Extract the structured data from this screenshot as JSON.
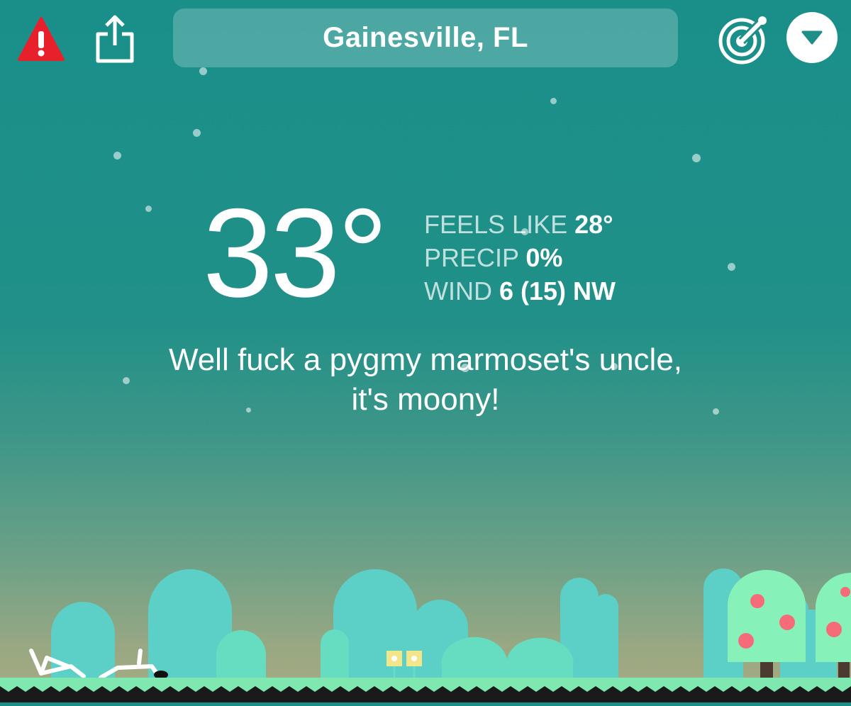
{
  "header": {
    "location": "Gainesville, FL",
    "alert_icon": "alert-triangle-icon",
    "share_icon": "share-icon",
    "radar_icon": "radar-icon",
    "menu_icon": "chevron-down-icon"
  },
  "weather": {
    "temperature": "33°",
    "feels_like_label": "FEELS LIKE",
    "feels_like_value": "28°",
    "precip_label": "PRECIP",
    "precip_value": "0%",
    "wind_label": "WIND",
    "wind_value": "6 (15) NW"
  },
  "message": {
    "line1": "Well fuck a pygmy marmoset's uncle,",
    "line2": "it's moony!"
  },
  "colors": {
    "sky_top": "#1a8f8a",
    "sky_bottom": "#a9ab80",
    "alert_red": "#e8202c",
    "hill_teal": "#5ccfc7",
    "bush_mint": "#66dcc0",
    "tree_green": "#86f2b9",
    "fruit_pink": "#f56b78",
    "grass": "#7ee8b0"
  }
}
